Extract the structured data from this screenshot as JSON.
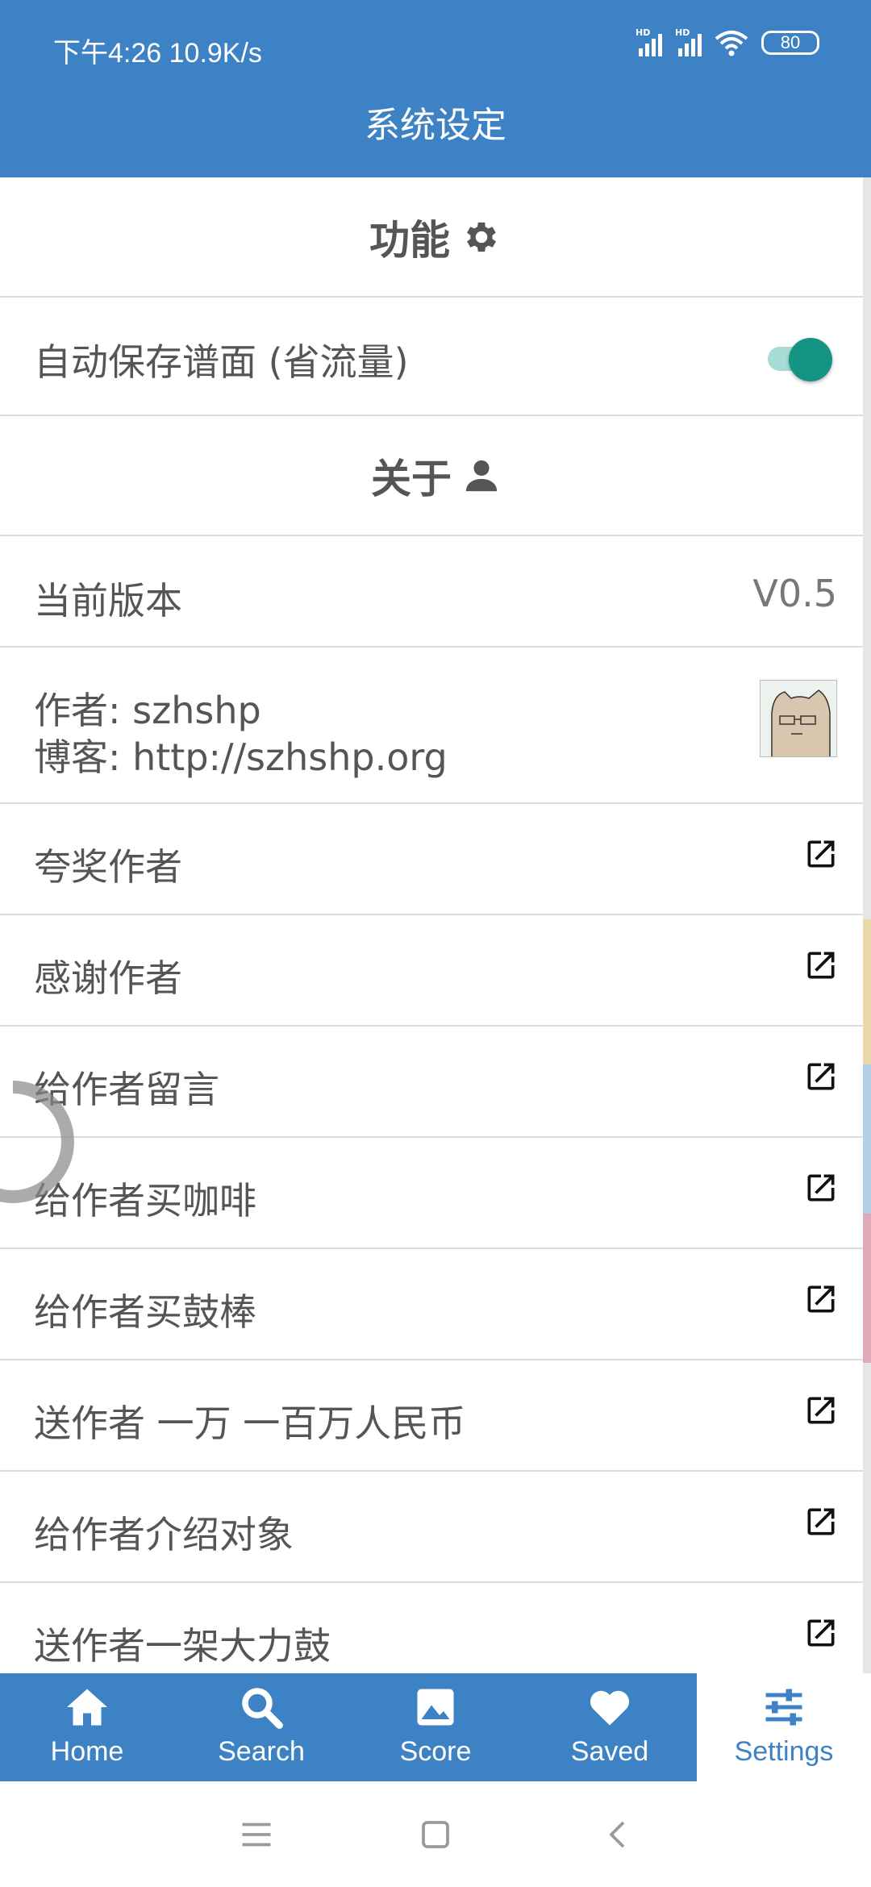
{
  "status_bar": {
    "time": "下午4:26 10.9K/s",
    "signal_1": "HD",
    "signal_2": "HD",
    "battery": "80",
    "icons": [
      "signal-icon",
      "signal-icon",
      "wifi-icon",
      "battery-icon"
    ]
  },
  "app_bar": {
    "title": "系统设定"
  },
  "sections": {
    "features": {
      "title": "功能",
      "icon": "gear-icon"
    },
    "about": {
      "title": "关于",
      "icon": "person-icon"
    }
  },
  "settings": {
    "auto_save": {
      "label": "自动保存谱面 (省流量)",
      "enabled": true
    }
  },
  "about": {
    "version_label": "当前版本",
    "version_value": "V0.5",
    "author_line": "作者: szhshp",
    "blog_line": "博客: http://szhshp.org"
  },
  "links": [
    {
      "label": "夸奖作者",
      "icon": "external-link-icon"
    },
    {
      "label": "感谢作者",
      "icon": "external-link-icon"
    },
    {
      "label": "给作者留言",
      "icon": "external-link-icon"
    },
    {
      "label": "给作者买咖啡",
      "icon": "external-link-icon"
    },
    {
      "label": "给作者买鼓棒",
      "icon": "external-link-icon"
    },
    {
      "label": "送作者 一万 一百万人民币",
      "icon": "external-link-icon"
    },
    {
      "label": "给作者介绍对象",
      "icon": "external-link-icon"
    },
    {
      "label": "送作者一架大力鼓",
      "icon": "external-link-icon"
    }
  ],
  "bottom_nav": {
    "active": "Settings",
    "items": [
      {
        "label": "Home",
        "icon": "home-icon"
      },
      {
        "label": "Search",
        "icon": "search-icon"
      },
      {
        "label": "Score",
        "icon": "image-icon"
      },
      {
        "label": "Saved",
        "icon": "heart-icon"
      },
      {
        "label": "Settings",
        "icon": "sliders-icon"
      }
    ]
  },
  "colors": {
    "primary": "#3d82c4",
    "toggle_on": "#149584",
    "toggle_track": "#a7dcd6",
    "text": "#555555",
    "divider": "#dcdcdc"
  }
}
